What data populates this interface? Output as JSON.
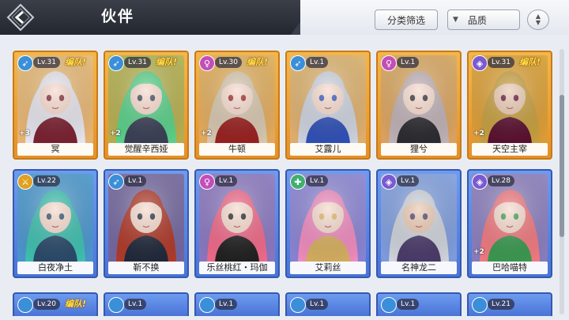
{
  "header": {
    "title": "伙伴",
    "filter_label": "分类筛选",
    "quality_label": "品质"
  },
  "colors": {
    "gold_frame": "#f4b64a",
    "blue_frame": "#6d9bf0",
    "team_tag": "#ffe24a"
  },
  "row1": [
    {
      "name": "冥",
      "level": "Lv.31",
      "team": "编队!",
      "stars": "+3",
      "class_color": "#3a8fd8",
      "class_icon": "bow-icon",
      "hair": "#e8e6ee",
      "skin": "#f6d9cc",
      "accent": "#7a2030"
    },
    {
      "name": "觉醒辛西娅",
      "level": "Lv.31",
      "team": "编队!",
      "stars": "+2",
      "class_color": "#3a8fd8",
      "class_icon": "bow-icon",
      "hair": "#5bd18a",
      "skin": "#f6d9cc",
      "accent": "#3a3f55"
    },
    {
      "name": "牛顿",
      "level": "Lv.30",
      "team": "编队!",
      "stars": "+2",
      "class_color": "#c24fb8",
      "class_icon": "mage-icon",
      "hair": "#d8c8b0",
      "skin": "#f6d9cc",
      "accent": "#9a2020"
    },
    {
      "name": "艾露儿",
      "level": "Lv.1",
      "team": "",
      "stars": "",
      "class_color": "#3a8fd8",
      "class_icon": "bow-icon",
      "hair": "#cfd4e0",
      "skin": "#f6d9cc",
      "accent": "#3050b8"
    },
    {
      "name": "狸兮",
      "level": "Lv.1",
      "team": "",
      "stars": "",
      "class_color": "#c24fb8",
      "class_icon": "mage-icon",
      "hair": "#c0b2b6",
      "skin": "#f6d9cc",
      "accent": "#2a2a30"
    },
    {
      "name": "天空主宰",
      "level": "Lv.31",
      "team": "编队!",
      "stars": "+2",
      "class_color": "#7a5ad0",
      "class_icon": "shield-icon",
      "hair": "#c8a040",
      "skin": "#e9c8b0",
      "accent": "#5a1030"
    }
  ],
  "row2": [
    {
      "name": "白夜净土",
      "level": "Lv.22",
      "team": "",
      "stars": "",
      "class_color": "#e0a020",
      "class_icon": "sword-icon",
      "hair": "#3fc0b0",
      "skin": "#f6d9cc",
      "accent": "#2a4a6a"
    },
    {
      "name": "靳不换",
      "level": "Lv.1",
      "team": "",
      "stars": "",
      "class_color": "#3a8fd8",
      "class_icon": "bow-icon",
      "hair": "#b03a2a",
      "skin": "#f6d9cc",
      "accent": "#20283a"
    },
    {
      "name": "乐丝桃红・玛伽",
      "level": "Lv.1",
      "team": "",
      "stars": "",
      "class_color": "#c24fb8",
      "class_icon": "mage-icon",
      "hair": "#f06a8a",
      "skin": "#f6d9cc",
      "accent": "#202020"
    },
    {
      "name": "艾莉丝",
      "level": "Lv.1",
      "team": "",
      "stars": "",
      "class_color": "#40b070",
      "class_icon": "heal-icon",
      "hair": "#f08cc0",
      "skin": "#f6d9cc",
      "accent": "#d8b060"
    },
    {
      "name": "名神龙二",
      "level": "Lv.1",
      "team": "",
      "stars": "",
      "class_color": "#7a5ad0",
      "class_icon": "shield-icon",
      "hair": "#d0d4dc",
      "skin": "#e9c8b0",
      "accent": "#4a3a6a"
    },
    {
      "name": "巴哈喵特",
      "level": "Lv.28",
      "team": "",
      "stars": "+2",
      "class_color": "#7a5ad0",
      "class_icon": "shield-icon",
      "hair": "#f07a80",
      "skin": "#f6d9cc",
      "accent": "#3a9a50"
    }
  ],
  "row3": [
    {
      "level": "Lv.20",
      "team": "编队!",
      "frame": "blue"
    },
    {
      "level": "Lv.1",
      "team": "",
      "frame": "blue"
    },
    {
      "level": "Lv.1",
      "team": "",
      "frame": "blue"
    },
    {
      "level": "Lv.1",
      "team": "",
      "frame": "blue"
    },
    {
      "level": "Lv.1",
      "team": "",
      "frame": "blue"
    },
    {
      "level": "Lv.21",
      "team": "",
      "frame": "blue"
    }
  ]
}
